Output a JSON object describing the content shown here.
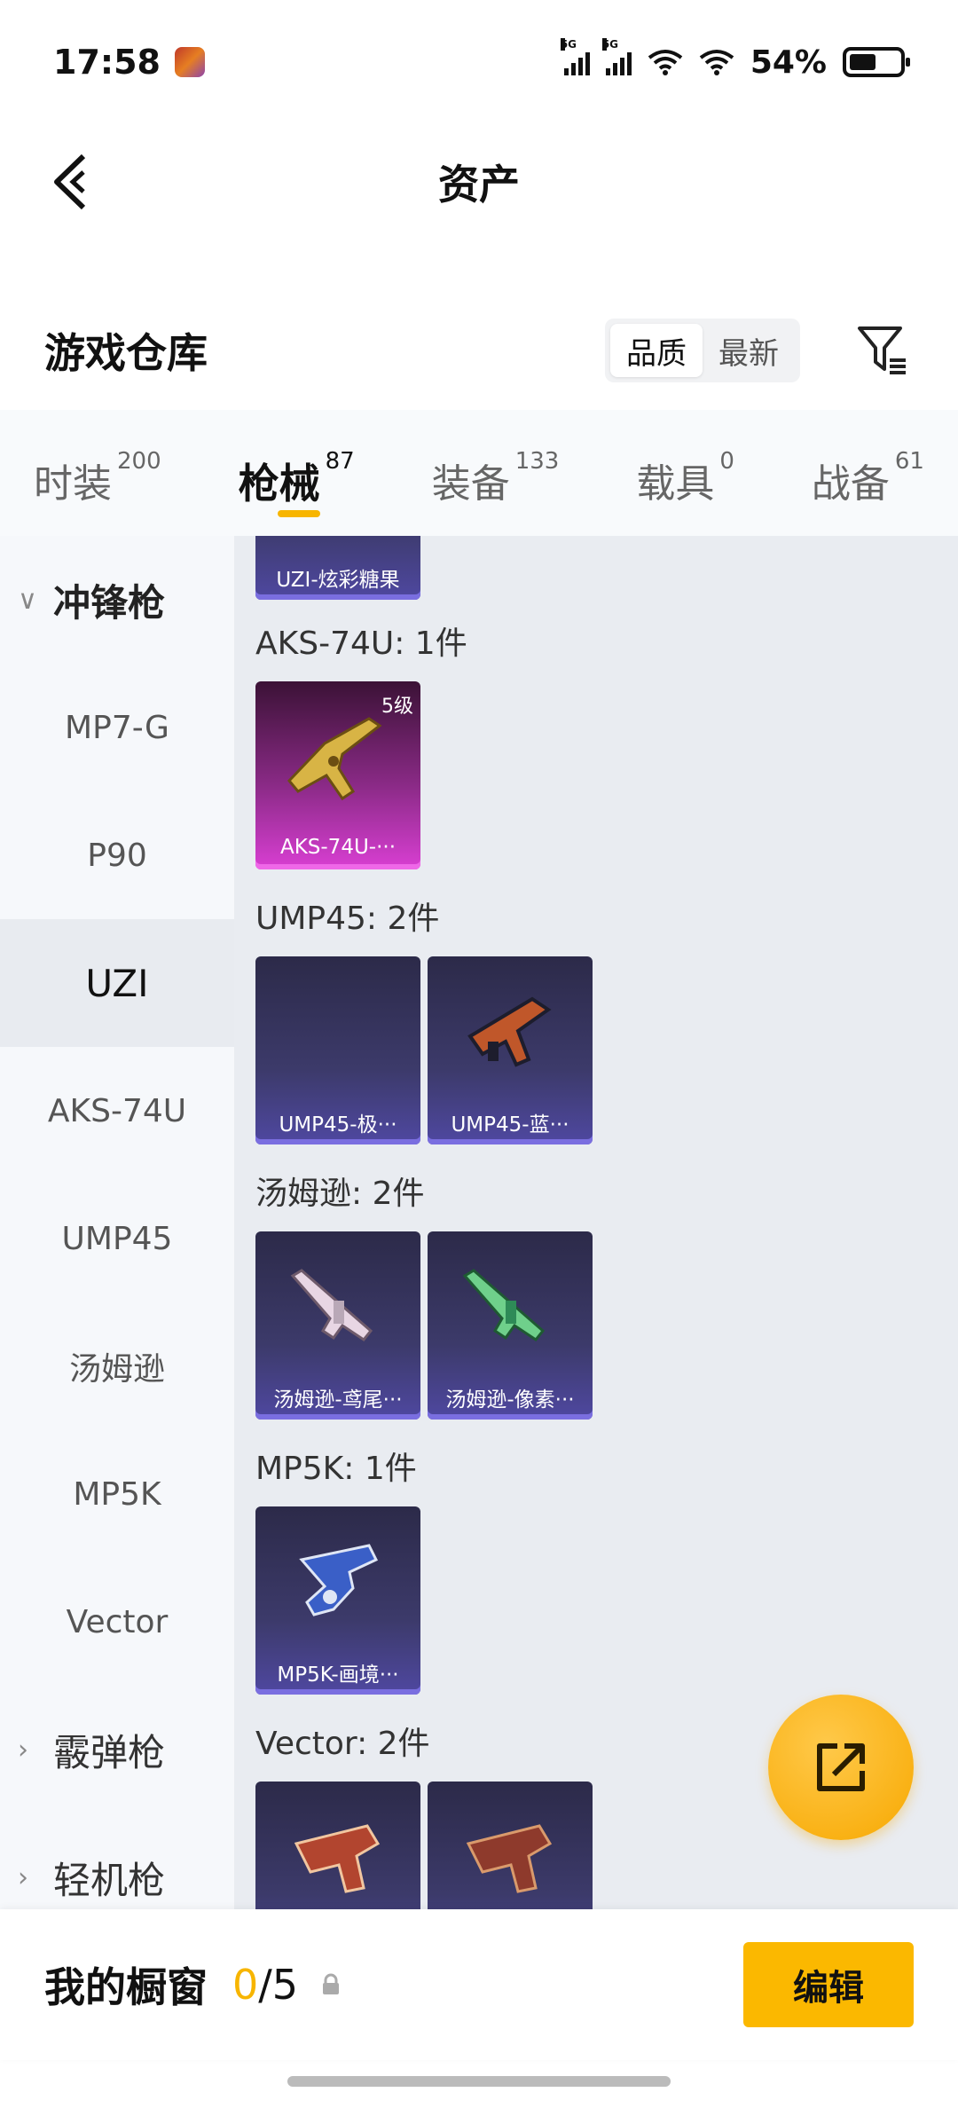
{
  "status": {
    "time": "17:58",
    "battery_text": "54%",
    "net1": "5G",
    "net2": "5G"
  },
  "header": {
    "title": "资产"
  },
  "warehouse": {
    "title": "游戏仓库",
    "sort_quality": "品质",
    "sort_newest": "最新"
  },
  "tabs": [
    {
      "label": "时装",
      "count": "200"
    },
    {
      "label": "枪械",
      "count": "87"
    },
    {
      "label": "装备",
      "count": "133"
    },
    {
      "label": "载具",
      "count": "0"
    },
    {
      "label": "战备",
      "count": "61"
    }
  ],
  "sidebar": {
    "group_smg": "冲锋枪",
    "items": [
      "MP7-G",
      "P90",
      "UZI",
      "AKS-74U",
      "UMP45",
      "汤姆逊",
      "MP5K",
      "Vector"
    ],
    "group_shotgun": "霰弹枪",
    "group_lmg": "轻机枪"
  },
  "content": {
    "uzi_card": "UZI-炫彩糖果",
    "sec_aks": "AKS-74U: 1件",
    "aks_card": "AKS-74U-···",
    "aks_level": "5级",
    "sec_ump": "UMP45: 2件",
    "ump_card1": "UMP45-极···",
    "ump_card2": "UMP45-蓝···",
    "sec_tom": "汤姆逊: 2件",
    "tom_card1": "汤姆逊-鸢尾···",
    "tom_card2": "汤姆逊-像素···",
    "sec_mp5": "MP5K: 1件",
    "mp5_card": "MP5K-画境···",
    "sec_vector": "Vector: 2件"
  },
  "bottom": {
    "title": "我的橱窗",
    "current": "0",
    "total": "/5",
    "edit": "编辑"
  },
  "colors": {
    "accent": "#f7b500",
    "card_purple": "#4f48a1",
    "card_pink": "#d93fd3"
  }
}
